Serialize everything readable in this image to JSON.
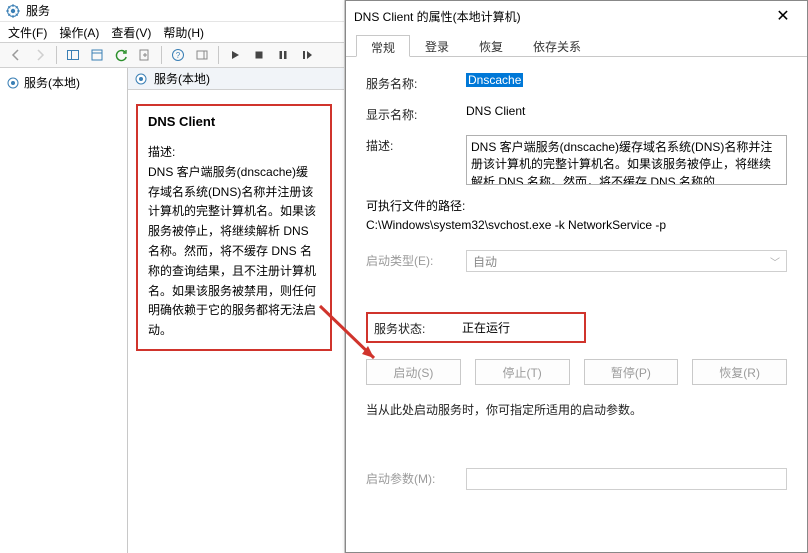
{
  "mmc": {
    "window_title": "服务",
    "menus": {
      "file": "文件(F)",
      "action": "操作(A)",
      "view": "查看(V)",
      "help": "帮助(H)"
    },
    "tree_root": "服务(本地)",
    "col_header": "服务(本地)",
    "detail": {
      "name": "DNS Client",
      "label": "描述:",
      "description": "DNS 客户端服务(dnscache)缓存域名系统(DNS)名称并注册该计算机的完整计算机名。如果该服务被停止，将继续解析 DNS 名称。然而，将不缓存 DNS 名称的查询结果，且不注册计算机名。如果该服务被禁用，则任何明确依赖于它的服务都将无法启动。"
    }
  },
  "dlg": {
    "title": "DNS Client 的属性(本地计算机)",
    "tabs": {
      "general": "常规",
      "logon": "登录",
      "recovery": "恢复",
      "depends": "依存关系"
    },
    "labels": {
      "service_name": "服务名称:",
      "display_name": "显示名称:",
      "description": "描述:",
      "exe_path": "可执行文件的路径:",
      "startup_type": "启动类型(E):",
      "service_status": "服务状态:",
      "start_params": "启动参数(M):"
    },
    "values": {
      "service_name": "Dnscache",
      "display_name": "DNS Client",
      "description": "DNS 客户端服务(dnscache)缓存域名系统(DNS)名称并注册该计算机的完整计算机名。如果该服务被停止，将继续解析 DNS 名称。然而，将不缓存 DNS 名称的",
      "exe_path": "C:\\Windows\\system32\\svchost.exe -k NetworkService -p",
      "startup_type": "自动",
      "service_status": "正在运行",
      "start_params": ""
    },
    "buttons": {
      "start": "启动(S)",
      "stop": "停止(T)",
      "pause": "暂停(P)",
      "resume": "恢复(R)"
    },
    "note": "当从此处启动服务时，你可指定所适用的启动参数。"
  }
}
